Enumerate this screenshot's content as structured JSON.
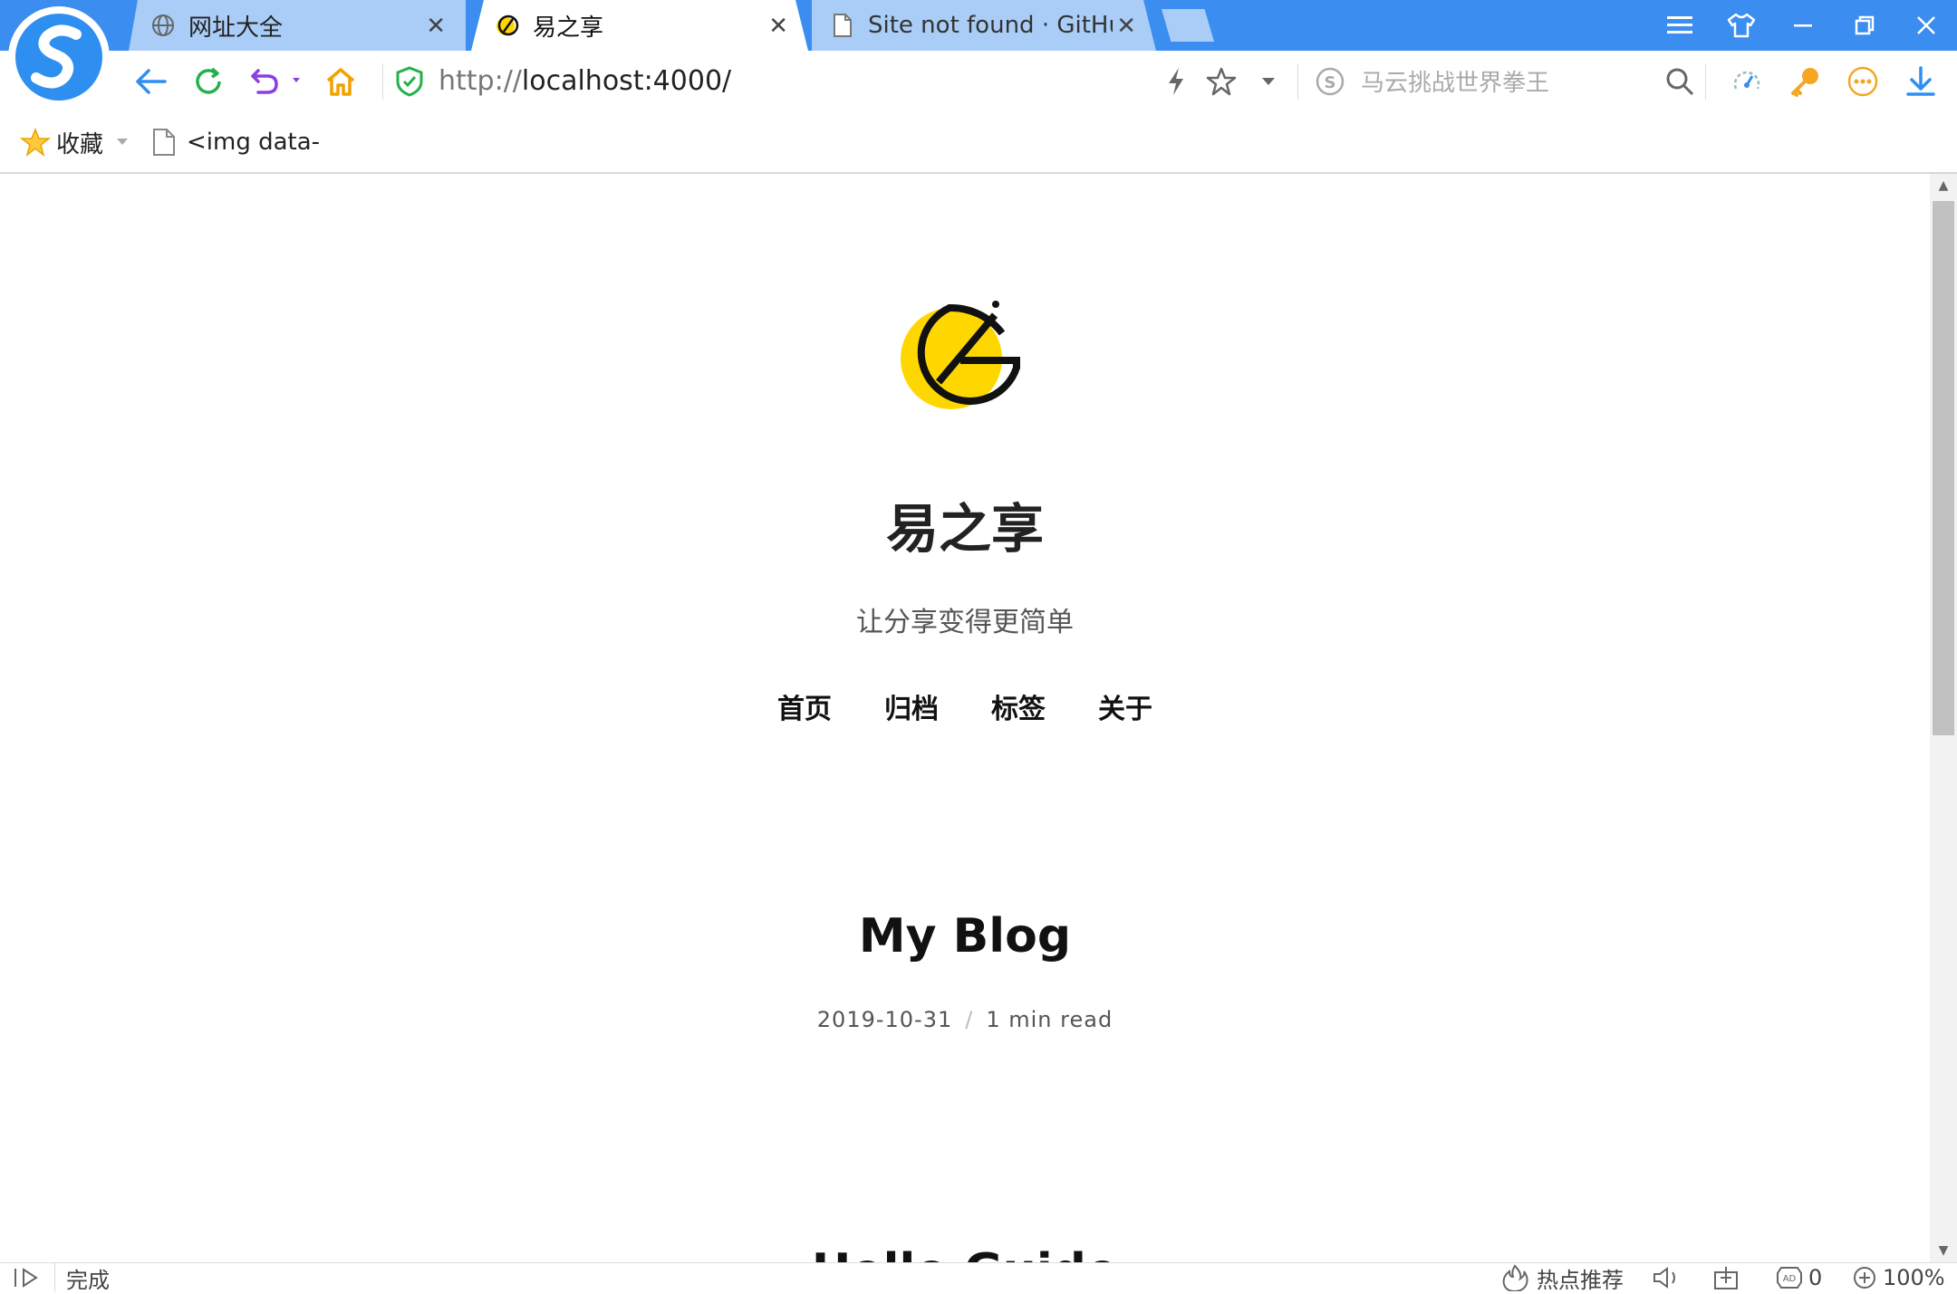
{
  "browser": {
    "tabs": [
      {
        "title": "网址大全",
        "icon": "globe-icon"
      },
      {
        "title": "易之享",
        "icon": "site-logo-icon"
      },
      {
        "title": "Site not found · GitHub",
        "icon": "page-icon"
      }
    ],
    "url": {
      "scheme": "http://",
      "host": "localhost:4000/"
    },
    "search_placeholder": "马云挑战世界拳王",
    "bookmarks": {
      "favorites_label": "收藏",
      "item1": "<img data-"
    },
    "status": {
      "left_text": "完成",
      "hot_label": "热点推荐",
      "adblock_count": "0",
      "zoom": "100%"
    },
    "colors": {
      "accent": "#3b8df0",
      "tab_inactive": "#a9cdf7",
      "logo_yellow": "#ffd700"
    }
  },
  "site": {
    "title": "易之享",
    "subtitle": "让分享变得更简单",
    "nav": [
      "首页",
      "归档",
      "标签",
      "关于"
    ],
    "posts": [
      {
        "title": "My Blog",
        "date": "2019-10-31",
        "read": "1 min read"
      },
      {
        "title": "Hello Guide"
      }
    ]
  }
}
